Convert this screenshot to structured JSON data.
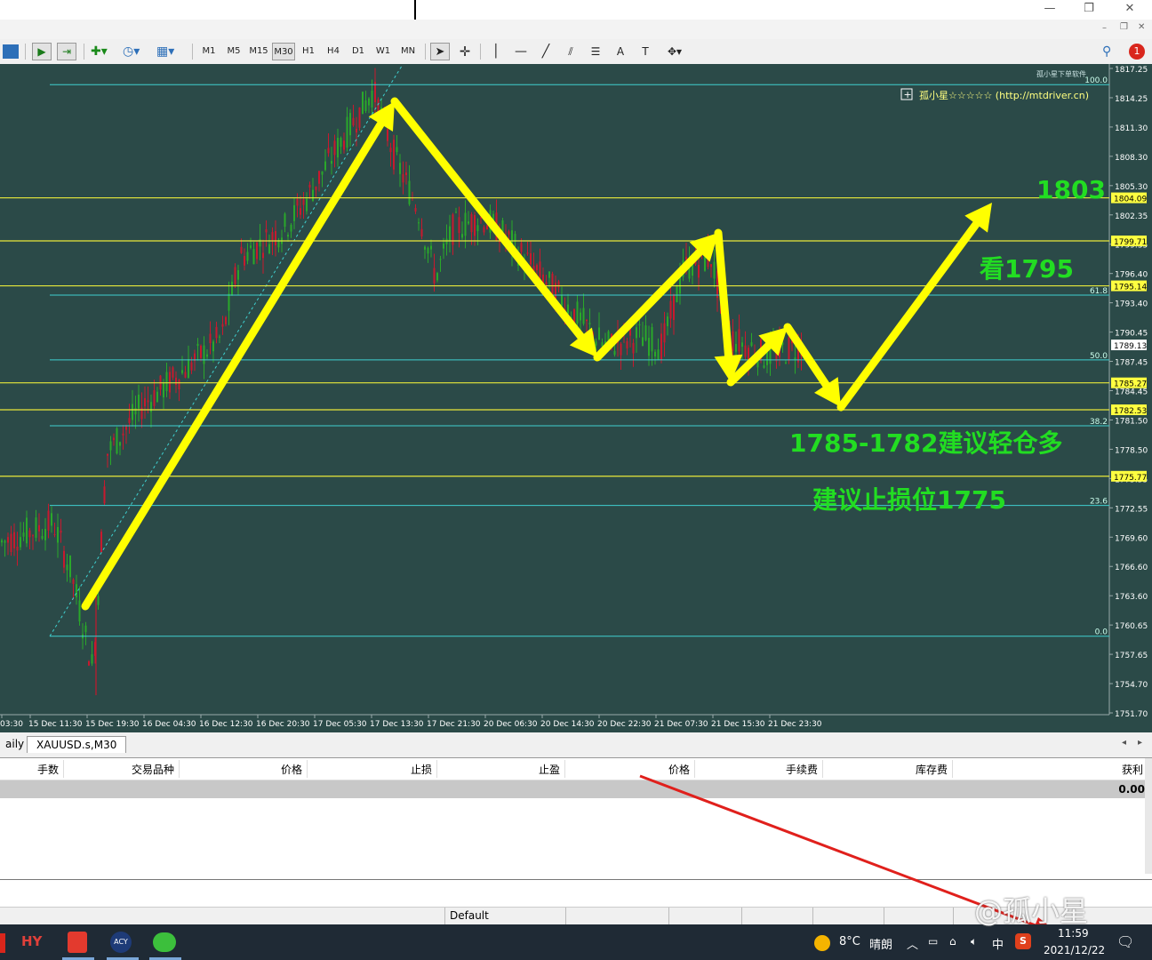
{
  "timeframes": [
    "M1",
    "M5",
    "M15",
    "M30",
    "H1",
    "H4",
    "D1",
    "W1",
    "MN"
  ],
  "active_timeframe": "M30",
  "notification_count": "1",
  "plugin_title": "孤小星下单软件",
  "plugin_label": "孤小星☆☆☆☆☆ (http://mtdriver.cn)",
  "price_axis": [
    "1817.25",
    "1814.25",
    "1811.30",
    "1808.30",
    "1805.30",
    "1802.35",
    "1799.35",
    "1796.40",
    "1793.40",
    "1790.45",
    "1787.45",
    "1784.45",
    "1781.50",
    "1778.50",
    "1775.55",
    "1772.55",
    "1769.60",
    "1766.60",
    "1763.60",
    "1760.65",
    "1757.65",
    "1754.70",
    "1751.70"
  ],
  "price_labels": [
    {
      "value": "1804.09",
      "level": 1804.09,
      "color": "#ffff40"
    },
    {
      "value": "1799.71",
      "level": 1799.71,
      "color": "#ffff40"
    },
    {
      "value": "1795.14",
      "level": 1795.14,
      "color": "#ffff40"
    },
    {
      "value": "1789.13",
      "level": 1789.13,
      "color": "#2b4a48"
    },
    {
      "value": "1785.27",
      "level": 1785.27,
      "color": "#ffff40"
    },
    {
      "value": "1782.53",
      "level": 1782.53,
      "color": "#ffff40"
    },
    {
      "value": "1775.77",
      "level": 1775.77,
      "color": "#ffff40"
    }
  ],
  "fib_levels": [
    {
      "label": "100.0",
      "price": 1815.6
    },
    {
      "label": "61.8",
      "price": 1794.2
    },
    {
      "label": "50.0",
      "price": 1787.6
    },
    {
      "label": "38.2",
      "price": 1780.9
    },
    {
      "label": "23.6",
      "price": 1772.8
    },
    {
      "label": "0.0",
      "price": 1759.5
    }
  ],
  "time_axis": [
    "03:30",
    "15 Dec 11:30",
    "15 Dec 19:30",
    "16 Dec 04:30",
    "16 Dec 12:30",
    "16 Dec 20:30",
    "17 Dec 05:30",
    "17 Dec 13:30",
    "17 Dec 21:30",
    "20 Dec 06:30",
    "20 Dec 14:30",
    "20 Dec 22:30",
    "21 Dec 07:30",
    "21 Dec 15:30",
    "21 Dec 23:30"
  ],
  "annotations": {
    "target": "1803",
    "view": "看1795",
    "entry": "1785-1782建议轻仓多",
    "stop": "建议止损位1775"
  },
  "chart_tabs": [
    "aily",
    "XAUUSD.s,M30"
  ],
  "active_chart_tab": "XAUUSD.s,M30",
  "terminal_columns": [
    "手数",
    "交易品种",
    "价格",
    "止损",
    "止盈",
    "价格",
    "手续费",
    "库存费",
    "获利"
  ],
  "terminal_total": "0.00",
  "status_profile": "Default",
  "taskbar": {
    "weather_temp": "8°C",
    "weather_text": "晴朗",
    "ime": "中",
    "time": "11:59",
    "date": "2021/12/22"
  },
  "watermark": "@孤小星",
  "colors": {
    "chart_bg": "#2b4a48",
    "fib": "#3fd0d0",
    "hline": "#e8e83a",
    "arrow": "#ffff00",
    "annotation": "#22dd22",
    "bull": "#2aa82a",
    "bear": "#c8192e"
  }
}
